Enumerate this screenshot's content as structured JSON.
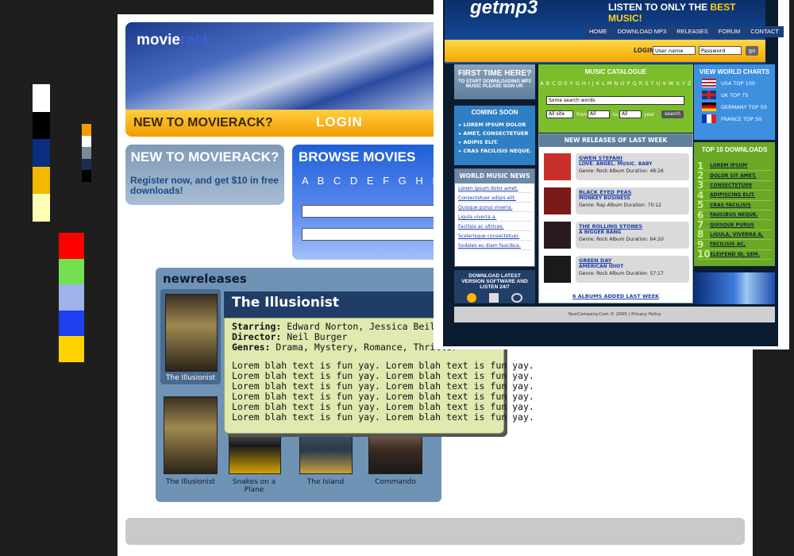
{
  "palette": {
    "group1": [
      "#ffffff",
      "#000000",
      "#0a2d80",
      "#f5b800",
      "#ffffb5"
    ],
    "group2": [
      "#f39a00",
      "#ffffff",
      "#7d879a",
      "#1b2d4e",
      "#000000"
    ],
    "group3": [
      "#ff0000",
      "#72e050",
      "#9fb3ea",
      "#1f3ff0",
      "#ffd200"
    ]
  },
  "movierack": {
    "logo_main": "movie",
    "logo_accent": "rack",
    "strip_new": "NEW TO MOVIERACK?",
    "strip_login": "LOGIN",
    "newbox_title": "NEW TO MOVIERACK?",
    "newbox_text": "Register now, and get $10 in free downloads!",
    "browse_title": "BROWSE MOVIES",
    "browse_letters": "A B C D E F G H I J K L M N",
    "new_releases_title": "newreleases",
    "films": [
      {
        "title": "The Illusionist"
      },
      {
        "title": "The Illusionist"
      },
      {
        "title": "Snakes on a Plane"
      },
      {
        "title": "The Island"
      },
      {
        "title": "Commando"
      }
    ],
    "tooltip": {
      "title": "The Illusionist",
      "starring_label": "Starring:",
      "starring": "Edward Norton, Jessica Beil",
      "director_label": "Director:",
      "director": "Neil Burger",
      "genres_label": "Genres:",
      "genres": "Drama, Mystery, Romance, Thriller",
      "lorem": [
        "Lorem blah text is fun yay.  Lorem blah text is fun yay.",
        "Lorem blah text is fun yay.  Lorem blah text is fun yay.",
        "Lorem blah text is fun yay.  Lorem blah text is fun yay.",
        "Lorem blah text is fun yay.  Lorem blah text is fun yay.",
        "Lorem blah text is fun yay.  Lorem blah text is fun yay.",
        "Lorem blah text is fun yay.  Lorem blah text is fun yay."
      ]
    }
  },
  "getmp3": {
    "logo": "getmp3",
    "tagline_a": "LISTEN TO ONLY THE ",
    "tagline_b": "BEST MUSIC!",
    "nav": [
      "HOME",
      "DOWNLOAD MP3",
      "RELEASES",
      "FORUM",
      "CONTACT"
    ],
    "login_label": "LOGIN",
    "username_placeholder": "User name",
    "password_placeholder": "Password",
    "go_label": "go",
    "first_time_title": "FIRST TIME HERE?",
    "first_time_text": "TO START DOWNLOADING MP3 MUSIC PLEASE SIGN UP.",
    "coming_soon_title": "COMING SOON",
    "coming_soon": [
      "LOREM IPSUM DOLOR",
      "AMET, CONSECTETUER",
      "ADIPIS ELIT.",
      "CRAS FACILISIS NEQUE."
    ],
    "world_news_title": "WORLD MUSIC NEWS",
    "world_news": [
      "Lorem ipsum dolor amet.",
      "Consectetuer adipis elit.",
      "Quisque purus viverra.",
      "Ligula viverra a.",
      "Facilisis ac ultrices.",
      "Scelerisque consectetuer.",
      "Sodales eu diam faucibus."
    ],
    "download_title": "DOWNLOAD LATEST VERSION SOFTWARE AND LISTEN 24/7",
    "catalogue_title": "MUSIC CATALOGUE",
    "catalogue_letters": "A B C D E F G H I J K L M N O P Q R S T U V W X Y Z",
    "search_value": "Some search words",
    "filter_site": "All site",
    "from_label": "from",
    "filter_from": "All",
    "to_label": "to",
    "filter_to": "All",
    "year_label": "year",
    "search_button": "search",
    "releases_title": "NEW RELEASES OF LAST WEEK",
    "albums": [
      {
        "artist": "GWEN STEFANI",
        "album": "LOVE. ANGEL. MUSIC. BABY",
        "genre": "Rock",
        "duration": "48:26",
        "color": "#c9302c"
      },
      {
        "artist": "BLACK EYED PEAS",
        "album": "MONKEY BUSINESS",
        "genre": "Rap",
        "duration": "70:12",
        "color": "#7a1a1a"
      },
      {
        "artist": "THE ROLLING STONES",
        "album": "A BIGGER BANG",
        "genre": "Rock",
        "duration": "64:20",
        "color": "#2a1a20"
      },
      {
        "artist": "GREEN DAY",
        "album": "AMERICAN IDIOT",
        "genre": "Rock",
        "duration": "57:17",
        "color": "#1a1a1a"
      }
    ],
    "genre_label": "Genre:",
    "duration_label": "Album Duration:",
    "albums_added": "6 ALBUMS ADDED LAST WEEK",
    "charts_title": "VIEW WORLD CHARTS",
    "charts": [
      "USA TOP 100",
      "UK TOP 75",
      "GERMANY TOP 50",
      "FRANCE TOP 50"
    ],
    "top10_title": "TOP 10 DOWNLOADS",
    "top10": [
      "LOREM IPSUM",
      "DOLOR SIT AMET,",
      "CONSECTETUER",
      "ADIPISCING ELIT.",
      "CRAS FACILISIS",
      "FAUCIBUS NEQUE.",
      "QUISQUE PURUS",
      "LIGULA, VIVERRA A,",
      "FACILISIS AC,",
      "ELEIFEND ID, SEM."
    ],
    "footer": "YourCompany.Com © 2005 | Privacy Policy"
  }
}
